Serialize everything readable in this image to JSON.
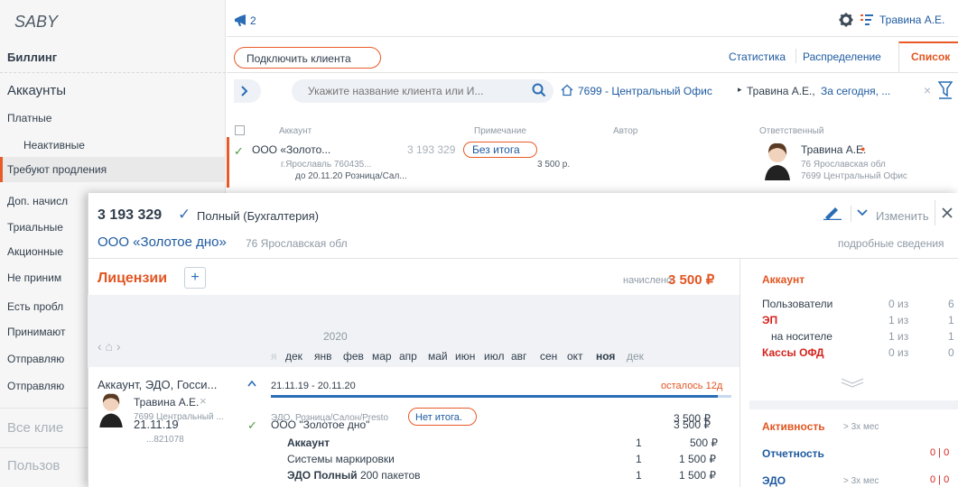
{
  "app": {
    "logo": "SABY",
    "section": "Биллинг"
  },
  "sidebar": {
    "heading": "Аккаунты",
    "items": [
      {
        "label": "Платные"
      },
      {
        "label": "Неактивные"
      },
      {
        "label": "Требуют продления"
      },
      {
        "label": "Доп. начисл"
      },
      {
        "label": "Триальные"
      },
      {
        "label": "Акционные"
      },
      {
        "label": "Не приним"
      },
      {
        "label": "Есть пробл"
      },
      {
        "label": "Принимают"
      },
      {
        "label": "Отправляю"
      },
      {
        "label": "Отправляю"
      }
    ],
    "all_clients": "Все клие",
    "users": "Пользов"
  },
  "topbar": {
    "notif_count": "2",
    "user_name": "Травина А.Е."
  },
  "toolbar": {
    "connect_button": "Подключить клиента",
    "tabs": [
      "Статистика",
      "Распределение",
      "Список"
    ]
  },
  "search": {
    "placeholder": "Укажите название клиента или И...",
    "office": "7699 - Центральный Офис",
    "crumb_user": "Травина А.Е.,",
    "crumb_period": "За сегодня, ..."
  },
  "columns": [
    "Аккаунт",
    "Примечание",
    "Автор",
    "Ответственный"
  ],
  "row": {
    "company": "ООО «Золото...",
    "account_no": "3 193 329",
    "note": "Без итога",
    "address": "г.Ярославль 760435...",
    "until": "до 20.11.20 Розница/Сал...",
    "amount": "3 500 р.",
    "resp_name": "Травина А.Е.",
    "resp_region": "76 Ярославская обл",
    "resp_office": "7699 Центральный Офис"
  },
  "panel": {
    "account_no": "3 193 329",
    "tariff": "Полный (Бухгалтерия)",
    "company": "ООО «Золотое дно»",
    "region": "76 Ярославская обл",
    "edit_label": "Изменить",
    "details_link": "подробные сведения",
    "licenses_title": "Лицензии",
    "accrued_label": "начислено",
    "accrued_amount": "3 500 ₽",
    "year": "2020",
    "months": [
      "я",
      "дек",
      "янв",
      "фев",
      "мар",
      "апр",
      "май",
      "июн",
      "июл",
      "авг",
      "сен",
      "окт",
      "ноя",
      "дек"
    ],
    "lic_name": "Аккаунт, ЭДО, Госси...",
    "lic_period": "21.11.19 - 20.11.20",
    "lic_remaining": "осталось 12д",
    "lic_user": "Травина А.Е.",
    "lic_office": "7699 Центральный ...",
    "lic_desc": "ЭДО, Розница/Салон/Presto",
    "lic_note": "Нет итога.",
    "lic_amount": "3 500 ₽",
    "doc_date": "21.11.19",
    "doc_no": "...821078",
    "doc_company": "ООО \"Золотое дно\"",
    "doc_total": "3 500 ₽",
    "doc_lines": [
      {
        "name": "Аккаунт",
        "bold": true,
        "suffix": "",
        "qty": "1",
        "sum": "500 ₽"
      },
      {
        "name": "Системы маркировки",
        "bold": false,
        "suffix": "",
        "qty": "1",
        "sum": "1 500 ₽"
      },
      {
        "name": "ЭДО Полный",
        "bold": true,
        "suffix": " 200 пакетов",
        "qty": "1",
        "sum": "1 500 ₽"
      }
    ]
  },
  "side_account": {
    "title": "Аккаунт",
    "rows": [
      {
        "label": "Пользователи",
        "mid": "0 из",
        "val": "6"
      },
      {
        "label": "ЭП",
        "mid": "1 из",
        "val": "1"
      },
      {
        "label": "на носителе",
        "mid": "1 из",
        "val": "1"
      },
      {
        "label": "Кассы ОФД",
        "mid": "0 из",
        "val": "0"
      }
    ]
  },
  "side_activity": {
    "title": "Активность",
    "period": "> 3х мес",
    "rows": [
      {
        "label": "Отчетность",
        "period": "",
        "val": "0 | 0"
      },
      {
        "label": "ЭДО",
        "period": "> 3х мес",
        "val": "0 | 0"
      }
    ]
  }
}
